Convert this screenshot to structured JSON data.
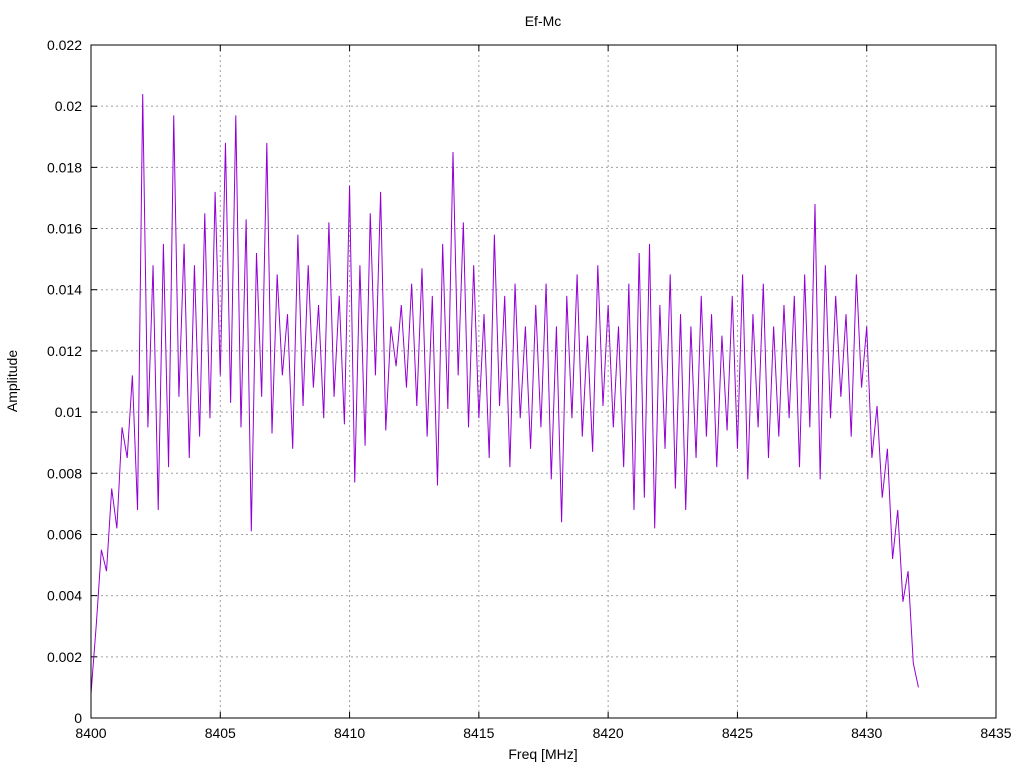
{
  "chart_data": {
    "type": "line",
    "title": "Ef-Mc",
    "xlabel": "Freq [MHz]",
    "ylabel": "Amplitude",
    "xlim": [
      8400,
      8435
    ],
    "ylim": [
      0,
      0.022
    ],
    "xticks": [
      "8400",
      "8405",
      "8410",
      "8415",
      "8420",
      "8425",
      "8430",
      "8435"
    ],
    "yticks": [
      "0",
      "0.002",
      "0.004",
      "0.006",
      "0.008",
      "0.01",
      "0.012",
      "0.014",
      "0.016",
      "0.018",
      "0.02",
      "0.022"
    ],
    "grid": true,
    "line_color": "#9400d3",
    "series": [
      {
        "name": "Ef-Mc",
        "x_start": 8400,
        "x_step": 0.2,
        "values": [
          0.0008,
          0.003,
          0.0055,
          0.0048,
          0.0075,
          0.0062,
          0.0095,
          0.0085,
          0.0112,
          0.0068,
          0.0204,
          0.0095,
          0.0148,
          0.0068,
          0.0155,
          0.0082,
          0.0197,
          0.0105,
          0.0155,
          0.0085,
          0.0148,
          0.0092,
          0.0165,
          0.0098,
          0.0172,
          0.0112,
          0.0188,
          0.0103,
          0.0197,
          0.0095,
          0.0163,
          0.0061,
          0.0152,
          0.0105,
          0.0188,
          0.0093,
          0.0145,
          0.0112,
          0.0132,
          0.0088,
          0.0158,
          0.0102,
          0.0148,
          0.0108,
          0.0135,
          0.0098,
          0.0162,
          0.0105,
          0.0138,
          0.0096,
          0.0174,
          0.0077,
          0.0148,
          0.0089,
          0.0165,
          0.0112,
          0.0172,
          0.0094,
          0.0128,
          0.0115,
          0.0135,
          0.0108,
          0.0142,
          0.0102,
          0.0147,
          0.0092,
          0.0138,
          0.0076,
          0.0155,
          0.0101,
          0.0185,
          0.0112,
          0.0162,
          0.0095,
          0.0148,
          0.0098,
          0.0132,
          0.0085,
          0.0158,
          0.0102,
          0.0138,
          0.0082,
          0.0142,
          0.0098,
          0.0128,
          0.0088,
          0.0135,
          0.0095,
          0.0142,
          0.0078,
          0.0128,
          0.0064,
          0.0138,
          0.0098,
          0.0145,
          0.0092,
          0.0125,
          0.0087,
          0.0148,
          0.0102,
          0.0135,
          0.0095,
          0.0128,
          0.0082,
          0.0142,
          0.0068,
          0.0152,
          0.0072,
          0.0155,
          0.0062,
          0.0135,
          0.0088,
          0.0145,
          0.0075,
          0.0132,
          0.0068,
          0.0128,
          0.0085,
          0.0138,
          0.0092,
          0.0132,
          0.0082,
          0.0125,
          0.0094,
          0.0138,
          0.0088,
          0.0145,
          0.0078,
          0.0132,
          0.0095,
          0.0142,
          0.0085,
          0.0128,
          0.0092,
          0.0135,
          0.0098,
          0.0138,
          0.0082,
          0.0145,
          0.0095,
          0.0168,
          0.0078,
          0.0148,
          0.0098,
          0.0138,
          0.0105,
          0.0132,
          0.0092,
          0.0145,
          0.0108,
          0.0128,
          0.0085,
          0.0102,
          0.0072,
          0.0088,
          0.0052,
          0.0068,
          0.0038,
          0.0048,
          0.0018,
          0.001
        ]
      }
    ]
  }
}
